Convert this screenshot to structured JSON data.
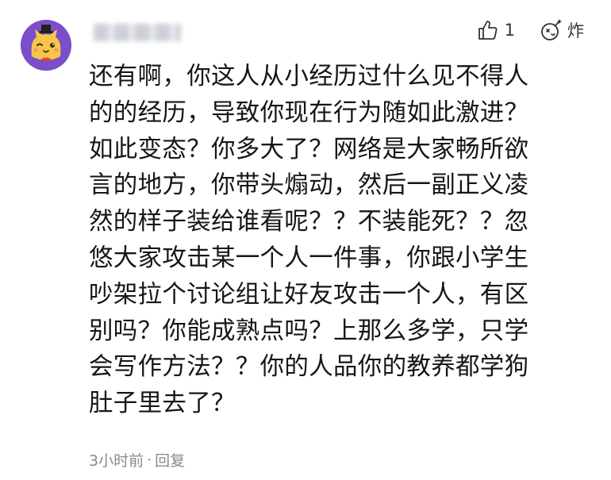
{
  "comment": {
    "username": "",
    "avatar_icon": "cat-avatar-icon",
    "like_icon": "thumbs-up-icon",
    "like_count": "1",
    "zha_icon": "bomb-icon",
    "zha_label": "炸",
    "lines": [
      "还有啊，你这人从小经历过什么见不得人",
      "的的经历，导致你现在行为随如此激进？",
      "如此变态？你多大了？网络是大家畅所欲",
      "言的地方，你带头煽动，然后一副正义凌",
      "然的样子装给谁看呢？？不装能死？？忽",
      "悠大家攻击某一个人一件事，你跟小学生",
      "吵架拉个讨论组让好友攻击一个人，有区",
      "别吗？你能成熟点吗？上那么多学，只学",
      "会写作方法？？你的人品你的教养都学狗",
      "肚子里去了？"
    ],
    "time": "3小时前",
    "separator": "·",
    "reply_label": "回复"
  },
  "colors": {
    "text": "#161616",
    "meta": "#8a8a8a",
    "avatar_bg": "#7a4fc9",
    "avatar_cat": "#f6c64a"
  }
}
